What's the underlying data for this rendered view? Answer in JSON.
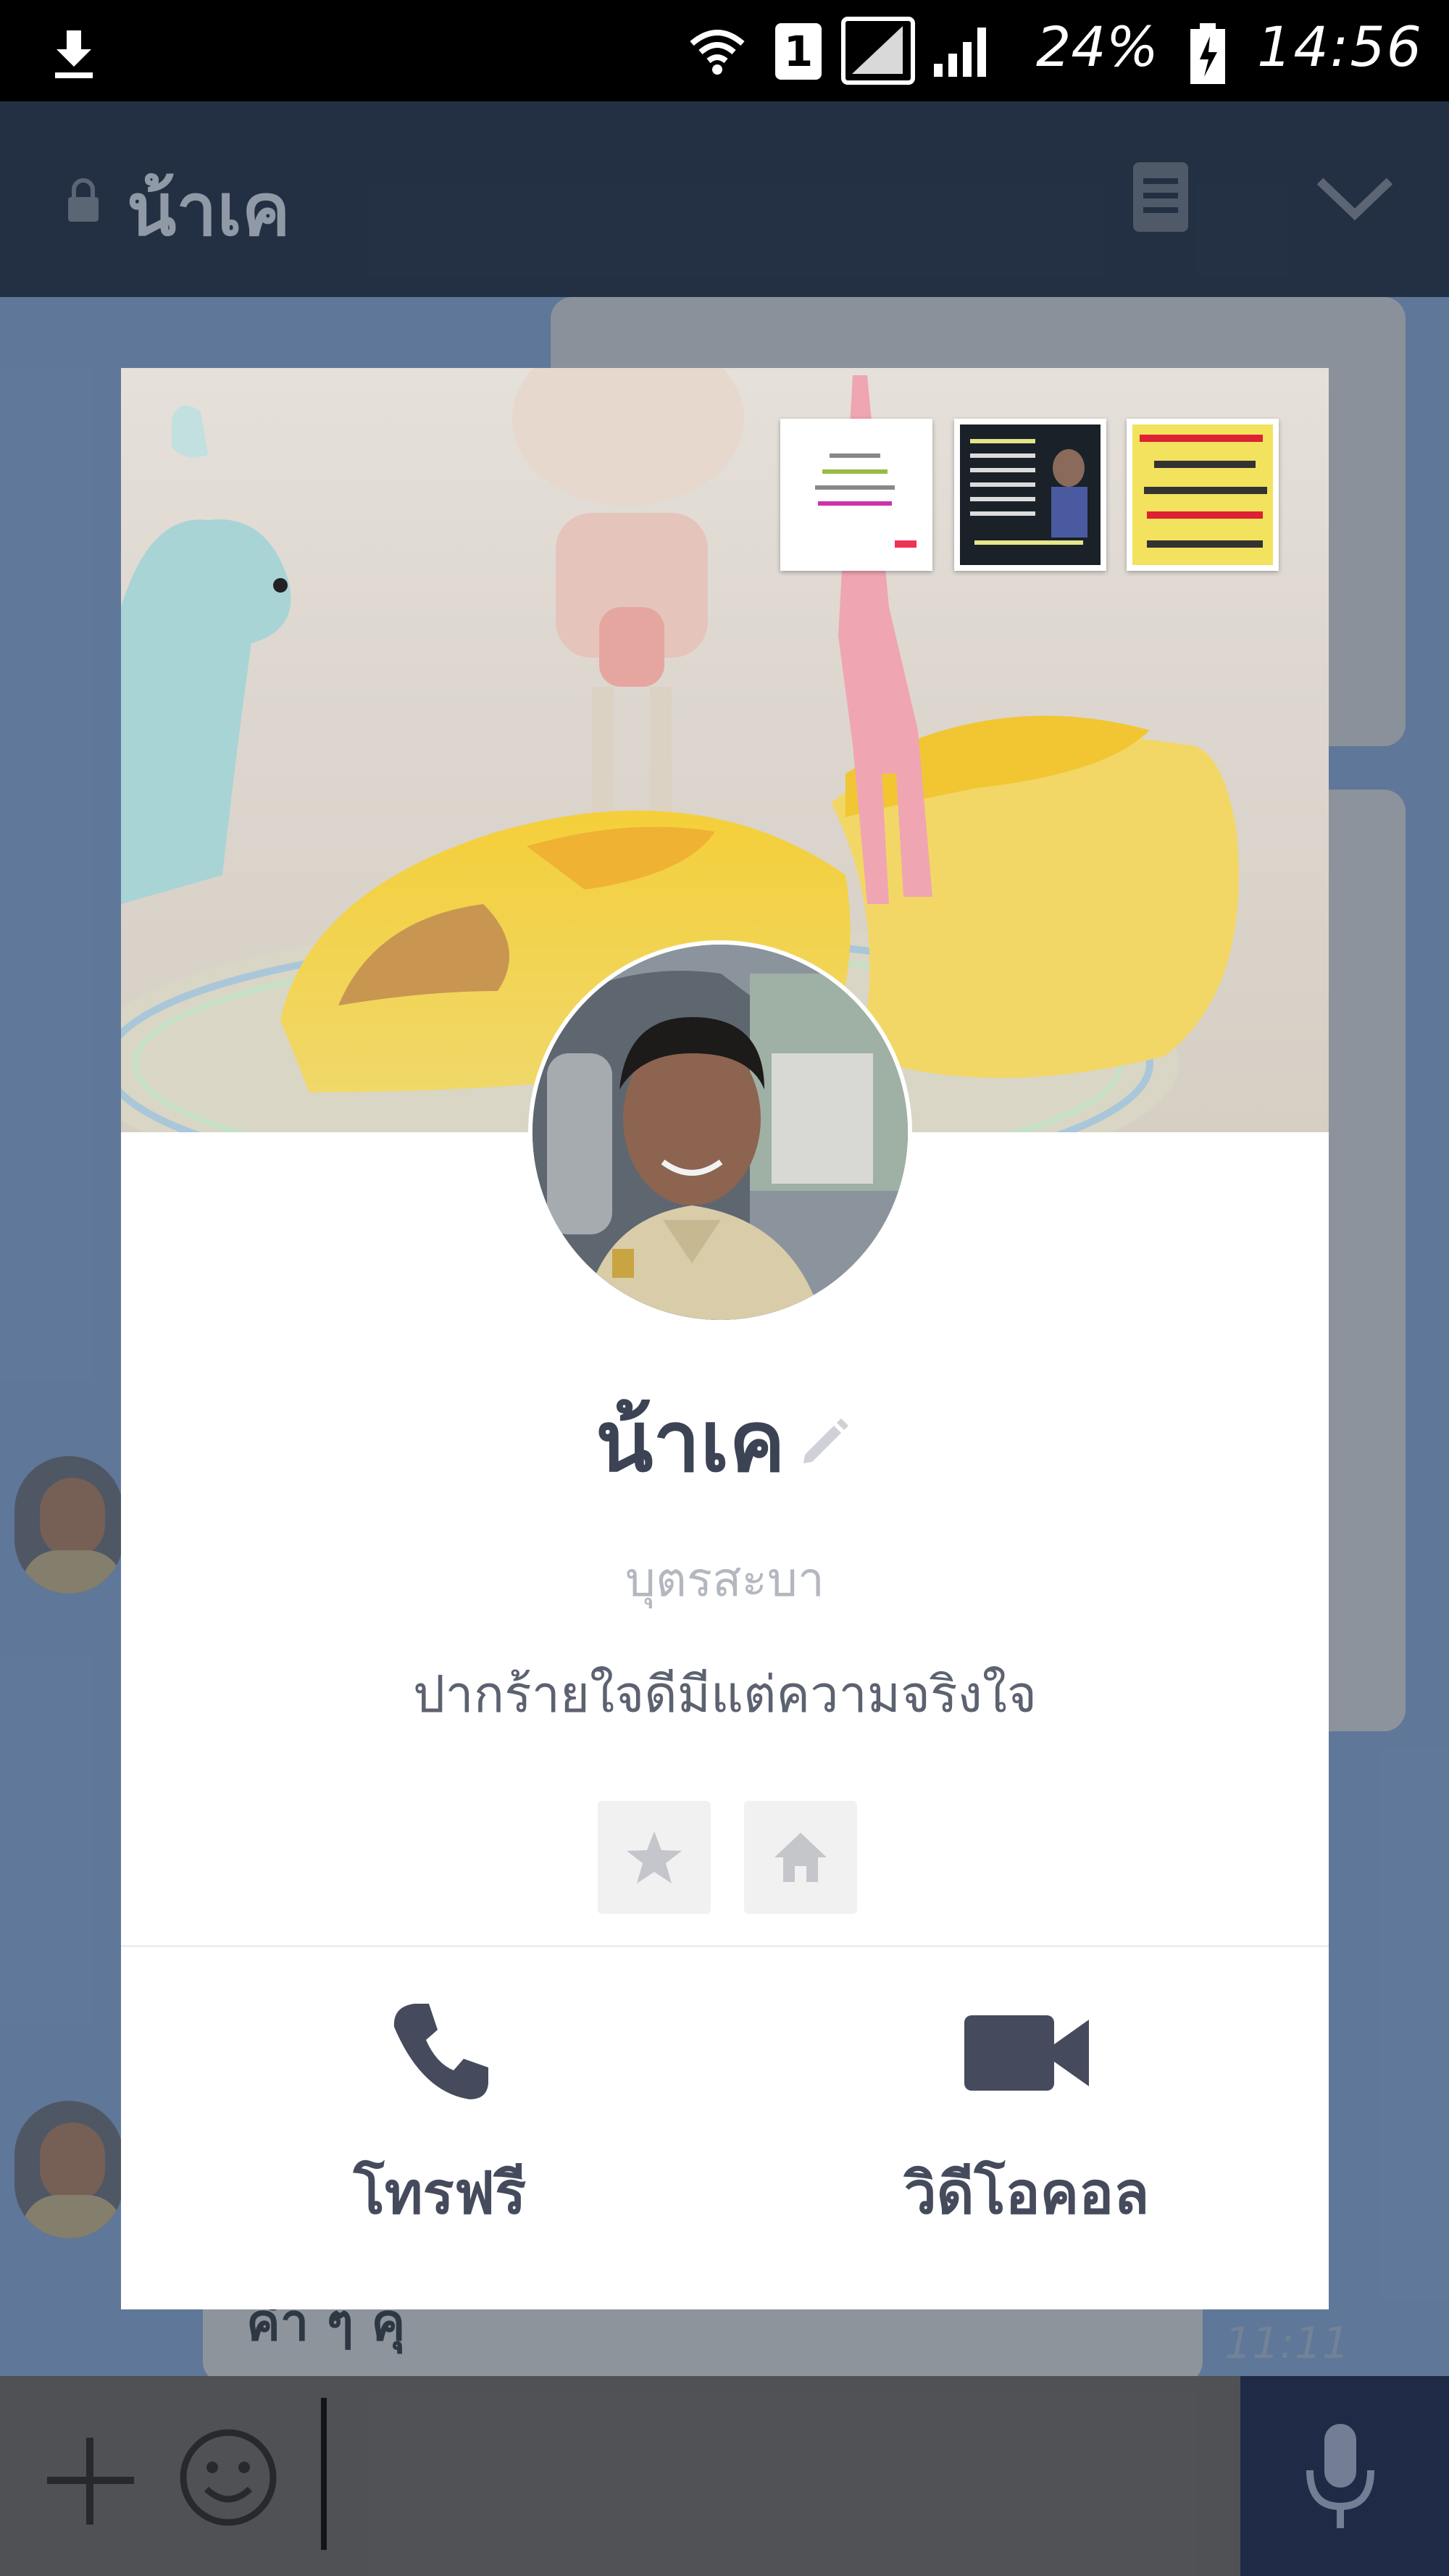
{
  "status_bar": {
    "sim_slot": "1",
    "battery_percent": "24%",
    "time": "14:56"
  },
  "chat_header": {
    "title": "น้าเค"
  },
  "chat_background": {
    "partial_bubble_text": "ค่ำ ๆ คุ",
    "partial_time": "11:11"
  },
  "profile": {
    "name": "น้าเค",
    "status_message": "บุตรสะบา",
    "bio": "ปากร้ายใจดีมีแต่ความจริงใจ",
    "actions": [
      {
        "label": "โทรฟรี",
        "icon": "phone-icon"
      },
      {
        "label": "วิดีโอคอล",
        "icon": "video-camera-icon"
      }
    ]
  },
  "colors": {
    "header_bg": "#253246",
    "card_bg": "#ffffff",
    "text_primary": "#3b4354",
    "icon_color": "#454b5c",
    "mic_bg": "#202d4a"
  }
}
